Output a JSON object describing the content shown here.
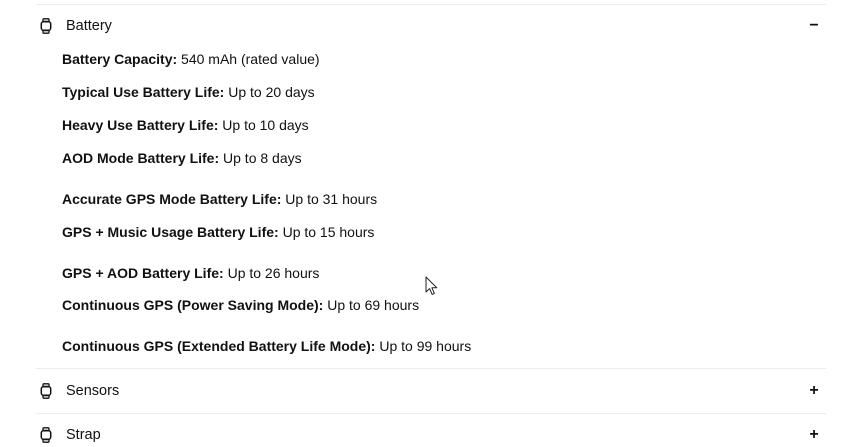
{
  "sections": {
    "battery": {
      "title": "Battery",
      "toggle": "−",
      "specs": [
        {
          "label": "Battery Capacity:",
          "value": "540 mAh (rated value)"
        },
        {
          "label": "Typical Use Battery Life:",
          "value": "Up to 20 days"
        },
        {
          "label": "Heavy Use Battery Life:",
          "value": "Up to 10 days"
        },
        {
          "label": "AOD Mode Battery Life:",
          "value": "Up to 8 days"
        },
        {
          "label": "Accurate GPS Mode Battery Life:",
          "value": "Up to 31 hours"
        },
        {
          "label": "GPS + Music Usage Battery Life:",
          "value": "Up to 15 hours"
        },
        {
          "label": "GPS + AOD Battery Life:",
          "value": "Up to 26 hours"
        },
        {
          "label": "Continuous GPS (Power Saving Mode):",
          "value": "Up to 69 hours"
        },
        {
          "label": "Continuous GPS (Extended Battery Life Mode):",
          "value": "Up to 99 hours"
        }
      ]
    },
    "sensors": {
      "title": "Sensors",
      "toggle": "+"
    },
    "strap": {
      "title": "Strap",
      "toggle": "+"
    }
  },
  "icons": {
    "section_icon": "watch-icon",
    "cursor": "mouse-pointer-icon"
  }
}
